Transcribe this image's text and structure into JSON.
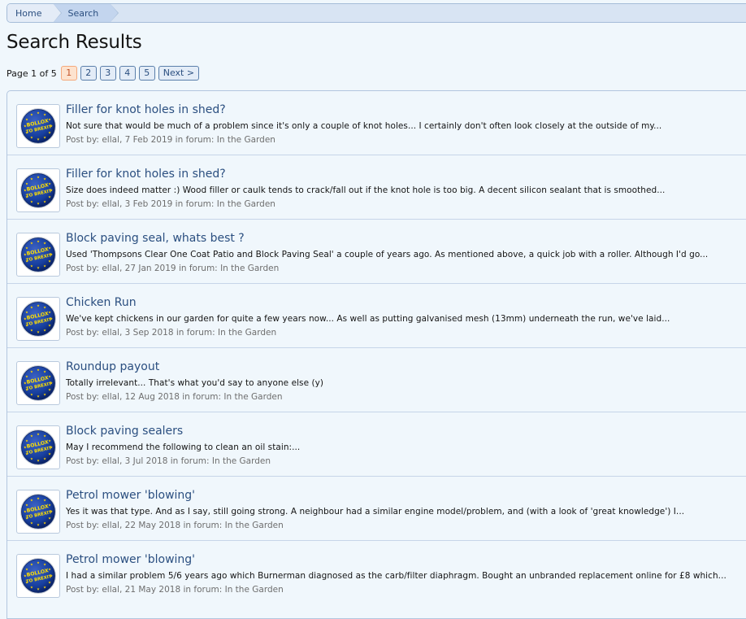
{
  "breadcrumb": {
    "home": "Home",
    "current": "Search"
  },
  "page_title": "Search Results",
  "pagination": {
    "label": "Page 1 of 5",
    "pages": [
      "1",
      "2",
      "3",
      "4",
      "5"
    ],
    "current": "1",
    "next": "Next >"
  },
  "avatar": {
    "icon": "bollox-to-brexit-badge",
    "badge_text_1": "BOLLOX",
    "badge_text_2": "TO BREXIT",
    "colors": {
      "ring": "#1a3a9a",
      "fill": "#173f9e",
      "stars": "#ffd400",
      "text": "#ffe000"
    }
  },
  "meta": {
    "post_by_label": "Post by:",
    "in_forum_label": "in forum:"
  },
  "results": [
    {
      "title": "Filler for knot holes in shed?",
      "snippet": "Not sure that would be much of a problem since it's only a couple of knot holes... I certainly don't often look closely at the outside of my...",
      "author": "ellal",
      "date": "7 Feb 2019",
      "forum": "In the Garden"
    },
    {
      "title": "Filler for knot holes in shed?",
      "snippet": "Size does indeed matter :) Wood filler or caulk tends to crack/fall out if the knot hole is too big. A decent silicon sealant that is smoothed...",
      "author": "ellal",
      "date": "3 Feb 2019",
      "forum": "In the Garden"
    },
    {
      "title": "Block paving seal, whats best ?",
      "snippet": "Used 'Thompsons Clear One Coat Patio and Block Paving Seal' a couple of years ago. As mentioned above, a quick job with a roller. Although I'd go...",
      "author": "ellal",
      "date": "27 Jan 2019",
      "forum": "In the Garden"
    },
    {
      "title": "Chicken Run",
      "snippet": "We've kept chickens in our garden for quite a few years now... As well as putting galvanised mesh (13mm) underneath the run, we've laid...",
      "author": "ellal",
      "date": "3 Sep 2018",
      "forum": "In the Garden"
    },
    {
      "title": "Roundup payout",
      "snippet": "Totally irrelevant... That's what you'd say to anyone else (y)",
      "author": "ellal",
      "date": "12 Aug 2018",
      "forum": "In the Garden"
    },
    {
      "title": "Block paving sealers",
      "snippet": "May I recommend the following to clean an oil stain:...",
      "author": "ellal",
      "date": "3 Jul 2018",
      "forum": "In the Garden"
    },
    {
      "title": "Petrol mower 'blowing'",
      "snippet": "Yes it was that type. And as I say, still going strong. A neighbour had a similar engine model/problem, and (with a look of 'great knowledge') I...",
      "author": "ellal",
      "date": "22 May 2018",
      "forum": "In the Garden"
    },
    {
      "title": "Petrol mower 'blowing'",
      "snippet": "I had a similar problem 5/6 years ago which Burnerman diagnosed as the carb/filter diaphragm. Bought an unbranded replacement online for £8 which...",
      "author": "ellal",
      "date": "21 May 2018",
      "forum": "In the Garden"
    }
  ]
}
